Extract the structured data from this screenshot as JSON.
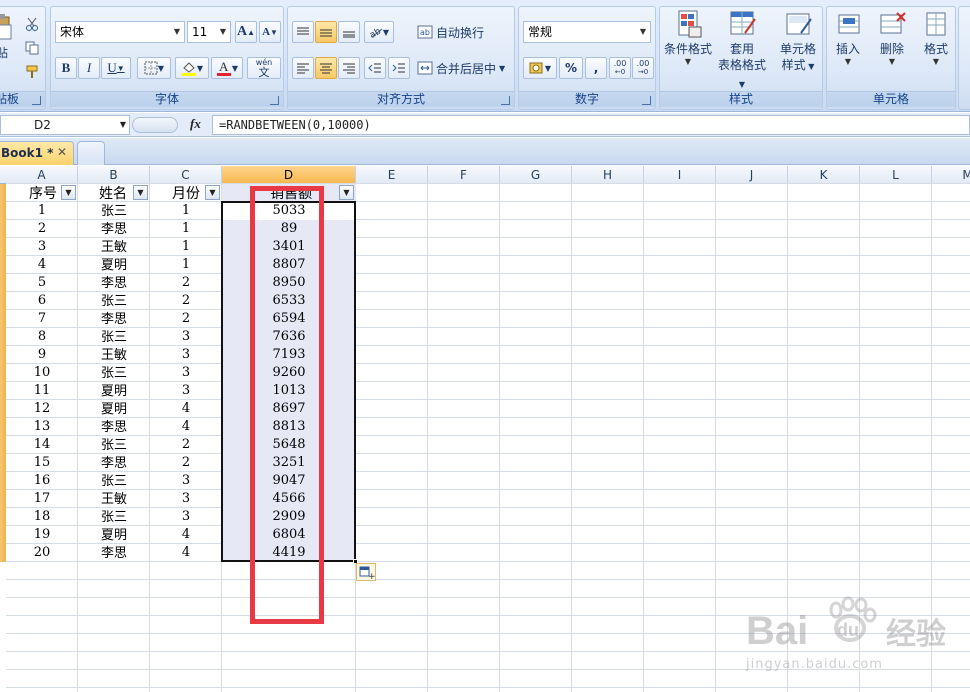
{
  "ribbon": {
    "clipboard": {
      "paste_label": "贴",
      "group_label": "贴板"
    },
    "font": {
      "font_name": "宋体",
      "font_size": "11",
      "grow_label": "A",
      "shrink_label": "A",
      "bold_label": "B",
      "italic_label": "I",
      "underline_label": "U",
      "phonetic_label": "wén",
      "phonetic_sub": "文",
      "group_label": "字体"
    },
    "alignment": {
      "wrap_label": "自动换行",
      "merge_label": "合并后居中",
      "group_label": "对齐方式"
    },
    "number": {
      "format": "常规",
      "percent_label": "%",
      "comma_label": ",",
      "inc_decimal_label": ".00",
      "dec_decimal_label": ".00",
      "group_label": "数字"
    },
    "styles": {
      "conditional_label": "条件格式",
      "table_label_1": "套用",
      "table_label_2": "表格格式",
      "cell_style_label_1": "单元格",
      "cell_style_label_2": "样式",
      "group_label": "样式"
    },
    "cells": {
      "insert_label": "插入",
      "delete_label": "删除",
      "format_label": "格式",
      "group_label": "单元格"
    }
  },
  "formula_bar": {
    "name_box": "D2",
    "fx_label": "fx",
    "formula": "=RANDBETWEEN(0,10000)"
  },
  "tabs": {
    "active_title": "Book1 *",
    "close_glyph": "✕"
  },
  "sheet": {
    "columns": [
      "A",
      "B",
      "C",
      "D",
      "E",
      "F",
      "G",
      "H",
      "I",
      "J",
      "K",
      "L",
      "M"
    ],
    "selected_column": "D",
    "headers": {
      "a": "序号",
      "b": "姓名",
      "c": "月份",
      "d": "销售额"
    },
    "rows": [
      [
        "1",
        "张三",
        "1",
        "5033"
      ],
      [
        "2",
        "李思",
        "1",
        "89"
      ],
      [
        "3",
        "王敏",
        "1",
        "3401"
      ],
      [
        "4",
        "夏明",
        "1",
        "8807"
      ],
      [
        "5",
        "李思",
        "2",
        "8950"
      ],
      [
        "6",
        "张三",
        "2",
        "6533"
      ],
      [
        "7",
        "李思",
        "2",
        "6594"
      ],
      [
        "8",
        "张三",
        "3",
        "7636"
      ],
      [
        "9",
        "王敏",
        "3",
        "7193"
      ],
      [
        "10",
        "张三",
        "3",
        "9260"
      ],
      [
        "11",
        "夏明",
        "3",
        "1013"
      ],
      [
        "12",
        "夏明",
        "4",
        "8697"
      ],
      [
        "13",
        "李思",
        "4",
        "8813"
      ],
      [
        "14",
        "张三",
        "2",
        "5648"
      ],
      [
        "15",
        "李思",
        "2",
        "3251"
      ],
      [
        "16",
        "张三",
        "3",
        "9047"
      ],
      [
        "17",
        "王敏",
        "3",
        "4566"
      ],
      [
        "18",
        "张三",
        "3",
        "2909"
      ],
      [
        "19",
        "夏明",
        "4",
        "6804"
      ],
      [
        "20",
        "李思",
        "4",
        "4419"
      ]
    ]
  },
  "annotation": {
    "color": "#e83a45"
  },
  "watermark": {
    "brand_latin": "Bai",
    "brand_latin_2": "du",
    "brand_cn": "经验",
    "url": "jingyan.baidu.com"
  }
}
